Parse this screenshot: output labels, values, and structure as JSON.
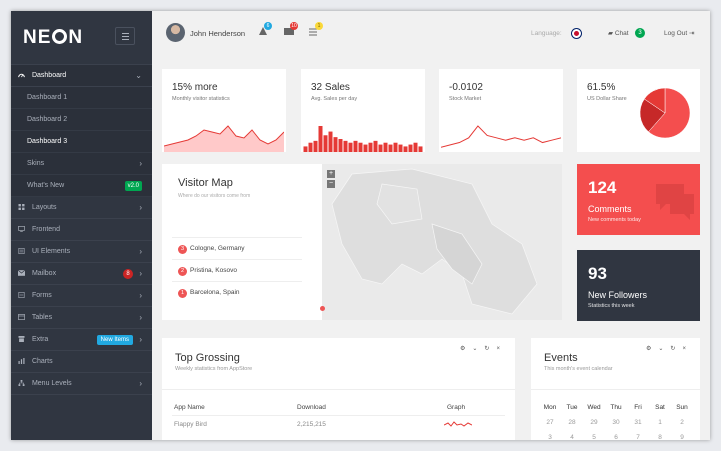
{
  "brand": {
    "logo_left": "NE",
    "logo_right": "N"
  },
  "sidebar": {
    "dashboard": "Dashboard",
    "subitems": [
      "Dashboard 1",
      "Dashboard 2",
      "Dashboard 3",
      "Skins",
      "What's New"
    ],
    "whats_new_badge": "v2.0",
    "items": [
      {
        "label": "Layouts",
        "icon": "layout-icon"
      },
      {
        "label": "Frontend",
        "icon": "monitor-icon"
      },
      {
        "label": "UI Elements",
        "icon": "ui-elements-icon"
      },
      {
        "label": "Mailbox",
        "icon": "mail-icon",
        "badge": "8"
      },
      {
        "label": "Forms",
        "icon": "forms-icon"
      },
      {
        "label": "Tables",
        "icon": "table-icon"
      },
      {
        "label": "Extra",
        "icon": "extra-icon",
        "badge": "New Items"
      },
      {
        "label": "Charts",
        "icon": "chart-icon"
      },
      {
        "label": "Menu Levels",
        "icon": "menu-levels-icon"
      }
    ]
  },
  "header": {
    "user": "John Henderson",
    "badges": [
      "6",
      "10",
      "1"
    ],
    "language_label": "Language:",
    "chat_label": "Chat",
    "chat_count": "3",
    "logout_label": "Log Out"
  },
  "stats": [
    {
      "value": "15% more",
      "label": "Monthly visitor statistics",
      "values": [
        3,
        4,
        5,
        6,
        8,
        11,
        10,
        9,
        13,
        8,
        7,
        11,
        6,
        4,
        6,
        10
      ]
    },
    {
      "value": "32 Sales",
      "label": "Avg. Sales per day",
      "values": [
        3,
        5,
        6,
        14,
        9,
        11,
        8,
        7,
        6,
        5,
        6,
        5,
        4,
        5,
        6,
        4,
        5,
        4,
        5,
        4,
        3,
        4,
        5,
        3
      ]
    },
    {
      "value": "-0.0102",
      "label": "Stock Market",
      "values": [
        2,
        3,
        4,
        6,
        11,
        7,
        6,
        5,
        6,
        5,
        6,
        4,
        5,
        6
      ]
    },
    {
      "value": "61.5%",
      "label": "US Dollar Share",
      "pie": [
        61.5,
        23,
        15.5
      ]
    }
  ],
  "map": {
    "title": "Visitor Map",
    "subtitle": "Where do our visitors come from",
    "locations": [
      {
        "n": "3",
        "name": "Cologne, Germany"
      },
      {
        "n": "2",
        "name": "Pristina, Kosovo"
      },
      {
        "n": "1",
        "name": "Barcelona, Spain"
      }
    ],
    "zoom_in": "+",
    "zoom_out": "−"
  },
  "tiles": {
    "comments": {
      "value": "124",
      "title": "Comments",
      "sub": "New comments today",
      "color": "#f44e4e"
    },
    "followers": {
      "value": "93",
      "title": "New Followers",
      "sub": "Statistics this week",
      "color": "#303641"
    }
  },
  "top_grossing": {
    "title": "Top Grossing",
    "subtitle": "Weekly statistics from AppStore",
    "columns": [
      "App Name",
      "Download",
      "Graph"
    ],
    "rows": [
      {
        "app": "Flappy Bird",
        "download": "2,215,215"
      }
    ]
  },
  "events": {
    "title": "Events",
    "subtitle": "This month's event calendar",
    "days": [
      "Mon",
      "Tue",
      "Wed",
      "Thu",
      "Fri",
      "Sat",
      "Sun"
    ],
    "row1": [
      "27",
      "28",
      "29",
      "30",
      "31",
      "1",
      "2"
    ],
    "row2": [
      "3",
      "4",
      "5",
      "6",
      "7",
      "8",
      "9"
    ]
  },
  "colors": {
    "sidebar": "#303641",
    "accent_red": "#f44e4e",
    "spark_red": "#e53935",
    "spark_fill": "#ffc9c9"
  }
}
